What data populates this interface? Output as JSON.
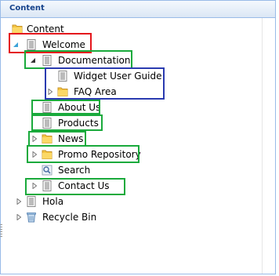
{
  "panel": {
    "title": "Content"
  },
  "tree": {
    "content": "Content",
    "welcome": "Welcome",
    "documentation": "Documentation",
    "widget_user_guide": "Widget User Guide",
    "faq_area": "FAQ Area",
    "about_us": "About Us",
    "products": "Products",
    "news": "News",
    "promo_repository": "Promo Repository",
    "search": "Search",
    "contact_us": "Contact Us",
    "hola": "Hola",
    "recycle_bin": "Recycle Bin"
  },
  "colors": {
    "highlight_red": "#e4161c",
    "highlight_green": "#1aaa3c",
    "highlight_blue": "#2a3bb0"
  }
}
